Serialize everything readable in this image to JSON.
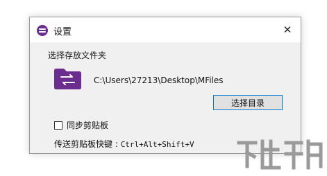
{
  "window": {
    "title": "设置",
    "close_glyph": "✕"
  },
  "folder_section": {
    "label": "选择存放文件夹",
    "path": "C:\\Users\\27213\\Desktop\\MFiles",
    "choose_button": "选择目录"
  },
  "sync_clipboard": {
    "label": "同步剪贴板",
    "checked": false
  },
  "shortcut": {
    "label": "传送剪贴板快键 :",
    "keys": "Ctrl+Alt+Shift+V"
  },
  "icons": {
    "app": "app-logo-icon",
    "folder": "folder-transfer-icon",
    "close": "close-icon"
  },
  "colors": {
    "accent_purple": "#6b2e8f",
    "button_focus_border": "#0078d7",
    "dialog_bg": "#f0f0f0"
  }
}
